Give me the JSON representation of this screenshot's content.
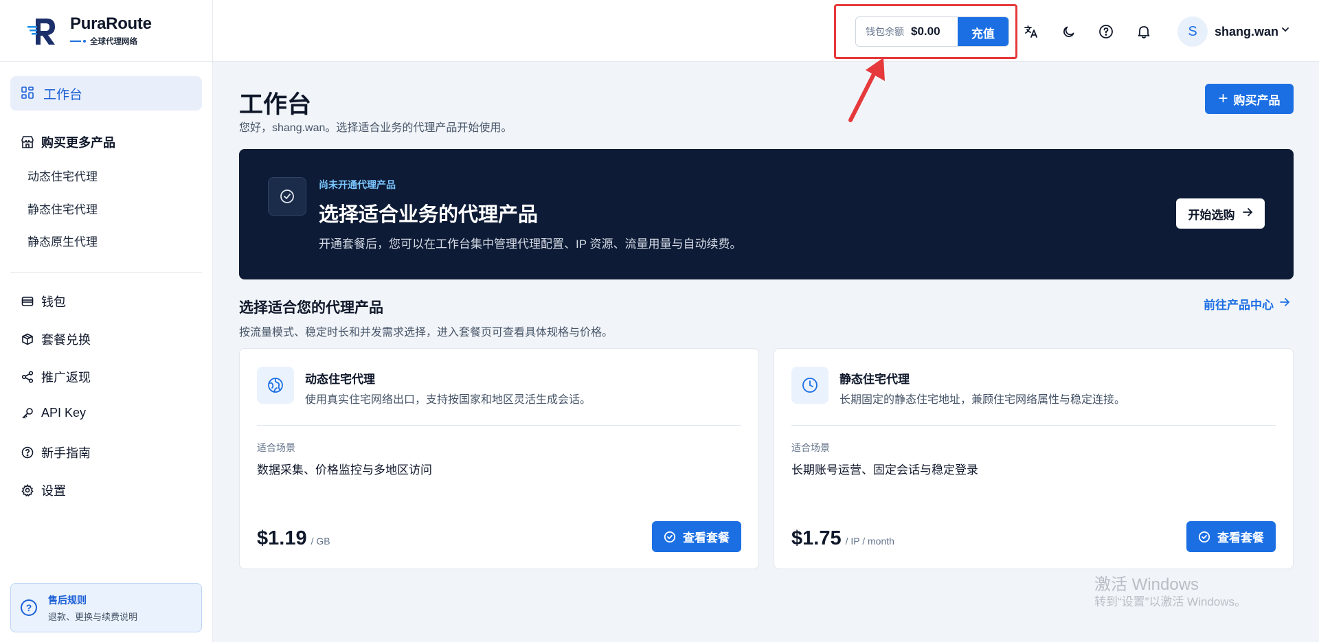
{
  "brand": {
    "name": "PuraRoute",
    "tagline": "全球代理网络"
  },
  "sidebar": {
    "active_item": "工作台",
    "buy_more_header": "购买更多产品",
    "sub_items": [
      "动态住宅代理",
      "静态住宅代理",
      "静态原生代理"
    ],
    "items": [
      "钱包",
      "套餐兑换",
      "推广返现",
      "API Key",
      "新手指南",
      "设置"
    ],
    "help": {
      "title": "售后规则",
      "desc": "退款、更换与续费说明"
    }
  },
  "topbar": {
    "wallet_label": "钱包余额",
    "wallet_amount": "$0.00",
    "recharge_label": "充值",
    "avatar_letter": "S",
    "username": "shang.wan",
    "icons": [
      "translate-icon",
      "moon-icon",
      "help-icon",
      "bell-icon"
    ]
  },
  "main": {
    "title": "工作台",
    "subtitle": "您好，shang.wan。选择适合业务的代理产品开始使用。",
    "buy_button": "购买产品",
    "banner": {
      "tag": "尚未开通代理产品",
      "title": "选择适合业务的代理产品",
      "desc": "开通套餐后，您可以在工作台集中管理代理配置、IP 资源、流量用量与自动续费。",
      "button": "开始选购"
    },
    "section": {
      "title": "选择适合您的代理产品",
      "desc": "按流量模式、稳定时长和并发需求选择，进入套餐页可查看具体规格与价格。",
      "link": "前往产品中心"
    },
    "cards": [
      {
        "title": "动态住宅代理",
        "desc": "使用真实住宅网络出口，支持按国家和地区灵活生成会话。",
        "scene_label": "适合场景",
        "scene": "数据采集、价格监控与多地区访问",
        "price": "$1.19",
        "unit": "/ GB",
        "button": "查看套餐"
      },
      {
        "title": "静态住宅代理",
        "desc": "长期固定的静态住宅地址，兼顾住宅网络属性与稳定连接。",
        "scene_label": "适合场景",
        "scene": "长期账号运营、固定会话与稳定登录",
        "price": "$1.75",
        "unit": "/ IP / month",
        "button": "查看套餐"
      }
    ]
  },
  "watermark": {
    "line1": "激活 Windows",
    "line2": "转到“设置”以激活 Windows。"
  },
  "colors": {
    "accent": "#1b6fe3",
    "banner_bg": "#0d1b36",
    "annotation": "#e5393b"
  }
}
